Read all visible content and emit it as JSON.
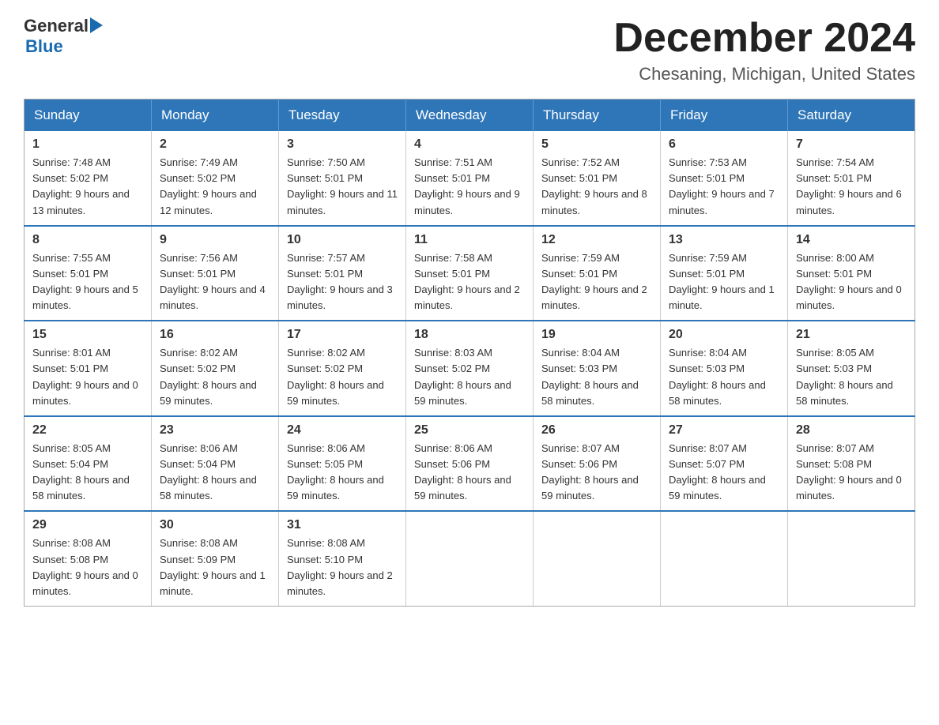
{
  "header": {
    "title": "December 2024",
    "subtitle": "Chesaning, Michigan, United States",
    "logo_general": "General",
    "logo_blue": "Blue"
  },
  "weekdays": [
    "Sunday",
    "Monday",
    "Tuesday",
    "Wednesday",
    "Thursday",
    "Friday",
    "Saturday"
  ],
  "weeks": [
    [
      {
        "day": "1",
        "sunrise": "7:48 AM",
        "sunset": "5:02 PM",
        "daylight": "9 hours and 13 minutes."
      },
      {
        "day": "2",
        "sunrise": "7:49 AM",
        "sunset": "5:02 PM",
        "daylight": "9 hours and 12 minutes."
      },
      {
        "day": "3",
        "sunrise": "7:50 AM",
        "sunset": "5:01 PM",
        "daylight": "9 hours and 11 minutes."
      },
      {
        "day": "4",
        "sunrise": "7:51 AM",
        "sunset": "5:01 PM",
        "daylight": "9 hours and 9 minutes."
      },
      {
        "day": "5",
        "sunrise": "7:52 AM",
        "sunset": "5:01 PM",
        "daylight": "9 hours and 8 minutes."
      },
      {
        "day": "6",
        "sunrise": "7:53 AM",
        "sunset": "5:01 PM",
        "daylight": "9 hours and 7 minutes."
      },
      {
        "day": "7",
        "sunrise": "7:54 AM",
        "sunset": "5:01 PM",
        "daylight": "9 hours and 6 minutes."
      }
    ],
    [
      {
        "day": "8",
        "sunrise": "7:55 AM",
        "sunset": "5:01 PM",
        "daylight": "9 hours and 5 minutes."
      },
      {
        "day": "9",
        "sunrise": "7:56 AM",
        "sunset": "5:01 PM",
        "daylight": "9 hours and 4 minutes."
      },
      {
        "day": "10",
        "sunrise": "7:57 AM",
        "sunset": "5:01 PM",
        "daylight": "9 hours and 3 minutes."
      },
      {
        "day": "11",
        "sunrise": "7:58 AM",
        "sunset": "5:01 PM",
        "daylight": "9 hours and 2 minutes."
      },
      {
        "day": "12",
        "sunrise": "7:59 AM",
        "sunset": "5:01 PM",
        "daylight": "9 hours and 2 minutes."
      },
      {
        "day": "13",
        "sunrise": "7:59 AM",
        "sunset": "5:01 PM",
        "daylight": "9 hours and 1 minute."
      },
      {
        "day": "14",
        "sunrise": "8:00 AM",
        "sunset": "5:01 PM",
        "daylight": "9 hours and 0 minutes."
      }
    ],
    [
      {
        "day": "15",
        "sunrise": "8:01 AM",
        "sunset": "5:01 PM",
        "daylight": "9 hours and 0 minutes."
      },
      {
        "day": "16",
        "sunrise": "8:02 AM",
        "sunset": "5:02 PM",
        "daylight": "8 hours and 59 minutes."
      },
      {
        "day": "17",
        "sunrise": "8:02 AM",
        "sunset": "5:02 PM",
        "daylight": "8 hours and 59 minutes."
      },
      {
        "day": "18",
        "sunrise": "8:03 AM",
        "sunset": "5:02 PM",
        "daylight": "8 hours and 59 minutes."
      },
      {
        "day": "19",
        "sunrise": "8:04 AM",
        "sunset": "5:03 PM",
        "daylight": "8 hours and 58 minutes."
      },
      {
        "day": "20",
        "sunrise": "8:04 AM",
        "sunset": "5:03 PM",
        "daylight": "8 hours and 58 minutes."
      },
      {
        "day": "21",
        "sunrise": "8:05 AM",
        "sunset": "5:03 PM",
        "daylight": "8 hours and 58 minutes."
      }
    ],
    [
      {
        "day": "22",
        "sunrise": "8:05 AM",
        "sunset": "5:04 PM",
        "daylight": "8 hours and 58 minutes."
      },
      {
        "day": "23",
        "sunrise": "8:06 AM",
        "sunset": "5:04 PM",
        "daylight": "8 hours and 58 minutes."
      },
      {
        "day": "24",
        "sunrise": "8:06 AM",
        "sunset": "5:05 PM",
        "daylight": "8 hours and 59 minutes."
      },
      {
        "day": "25",
        "sunrise": "8:06 AM",
        "sunset": "5:06 PM",
        "daylight": "8 hours and 59 minutes."
      },
      {
        "day": "26",
        "sunrise": "8:07 AM",
        "sunset": "5:06 PM",
        "daylight": "8 hours and 59 minutes."
      },
      {
        "day": "27",
        "sunrise": "8:07 AM",
        "sunset": "5:07 PM",
        "daylight": "8 hours and 59 minutes."
      },
      {
        "day": "28",
        "sunrise": "8:07 AM",
        "sunset": "5:08 PM",
        "daylight": "9 hours and 0 minutes."
      }
    ],
    [
      {
        "day": "29",
        "sunrise": "8:08 AM",
        "sunset": "5:08 PM",
        "daylight": "9 hours and 0 minutes."
      },
      {
        "day": "30",
        "sunrise": "8:08 AM",
        "sunset": "5:09 PM",
        "daylight": "9 hours and 1 minute."
      },
      {
        "day": "31",
        "sunrise": "8:08 AM",
        "sunset": "5:10 PM",
        "daylight": "9 hours and 2 minutes."
      },
      null,
      null,
      null,
      null
    ]
  ]
}
